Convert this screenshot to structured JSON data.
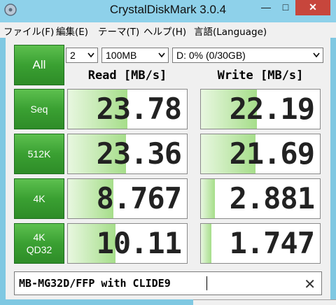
{
  "window": {
    "title": "CrystalDiskMark 3.0.4",
    "minimize_glyph": "—",
    "maximize_glyph": "□",
    "close_glyph": "✕"
  },
  "menu": [
    "ファイル(F)",
    "編集(E)",
    "テーマ(T)",
    "ヘルプ(H)",
    "言語(Language)"
  ],
  "controls": {
    "all_button": "All",
    "runs": "2",
    "size": "100MB",
    "drive": "D: 0% (0/30GB)"
  },
  "headers": {
    "read": "Read [MB/s]",
    "write": "Write [MB/s]"
  },
  "tests": [
    {
      "line1": "Seq",
      "line2": "",
      "read": "23.78",
      "write": "22.19",
      "read_fill": 0.5,
      "write_fill": 0.47
    },
    {
      "line1": "512K",
      "line2": "",
      "read": "23.36",
      "write": "21.69",
      "read_fill": 0.49,
      "write_fill": 0.46
    },
    {
      "line1": "4K",
      "line2": "",
      "read": "8.767",
      "write": "2.881",
      "read_fill": 0.38,
      "write_fill": 0.12
    },
    {
      "line1": "4K",
      "line2": "QD32",
      "read": "10.11",
      "write": "1.747",
      "read_fill": 0.4,
      "write_fill": 0.09
    }
  ],
  "comment": {
    "value": "MB-MG32D/FFP with CLIDE9",
    "clear_glyph": "✕"
  },
  "colors": {
    "button_green": "#3aa032",
    "titlebar": "#8ed1ea",
    "close": "#c7463c",
    "bar_fill": "#a6de8a"
  }
}
